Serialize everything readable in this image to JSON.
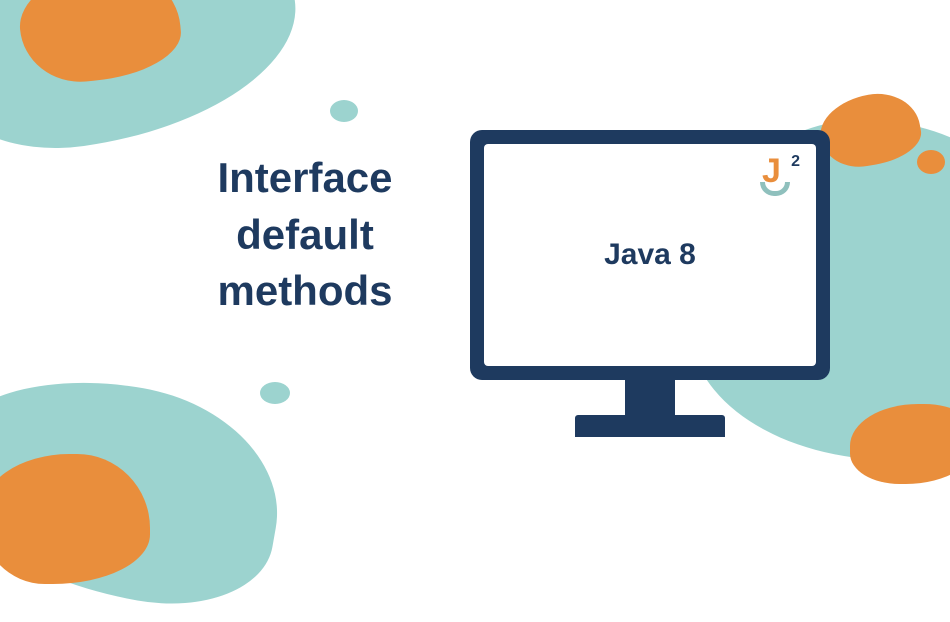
{
  "heading": {
    "line1": "Interface",
    "line2": "default",
    "line3": "methods"
  },
  "screen": {
    "text": "Java 8"
  },
  "logo": {
    "letter": "J",
    "superscript": "2"
  },
  "colors": {
    "navy": "#1e3a5f",
    "teal": "#9cd3cf",
    "orange": "#e98e3c"
  }
}
